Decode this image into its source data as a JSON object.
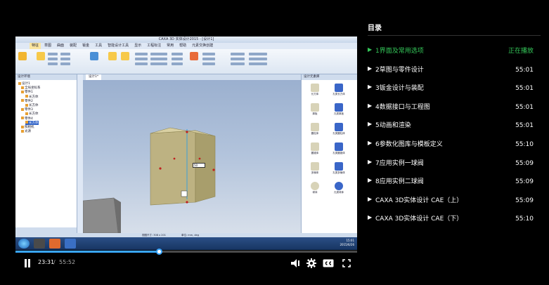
{
  "video": {
    "app_title": "CAXA 3D 实体设计2015 - [设计1]",
    "menu": [
      "特征",
      "草图",
      "曲面",
      "装配",
      "钣金",
      "工具",
      "智能设计工具",
      "显示",
      "工程标注",
      "常用",
      "帮助",
      "元素交换创建"
    ],
    "tree_header": "设计环境",
    "tree_items": [
      "设计1",
      "全局坐标系",
      "零件1",
      "长方体",
      "零件2",
      "长方体",
      "零件3",
      "长方体",
      "零件4",
      "长方体",
      "照相机",
      "光源"
    ],
    "tree_tabs": [
      "设置",
      "设计树",
      "属性"
    ],
    "viewport_tab": "设计1*",
    "dimension_value": "50",
    "right_panel_header": "设计元素库",
    "right_panel_items": [
      "长方体",
      "孔类长方体",
      "厚板",
      "孔类厚板",
      "圆柱体",
      "孔类圆柱体",
      "圆锥体",
      "孔类圆锥体",
      "多棱体",
      "孔类多棱体",
      "球体",
      "孔类球体"
    ],
    "status_text": "视图尺寸: 308 x 201",
    "status_unit": "单位: mm, deg",
    "taskbar_clock": "15:01",
    "taskbar_date": "2015/6/26",
    "taskbar_url": "http://www.caxa.cn"
  },
  "player": {
    "current_time": "23:31",
    "separator": "/",
    "total_time": "55:52",
    "progress": 0.421,
    "accent_color": "#3aa6ff"
  },
  "playlist": {
    "title": "目录",
    "items": [
      {
        "name": "1界面及常用选项",
        "duration": "正在播放",
        "active": true
      },
      {
        "name": "2草图与零件设计",
        "duration": "55:01",
        "active": false
      },
      {
        "name": "3钣金设计与装配",
        "duration": "55:01",
        "active": false
      },
      {
        "name": "4数据接口与工程图",
        "duration": "55:01",
        "active": false
      },
      {
        "name": "5动画和渲染",
        "duration": "55:01",
        "active": false
      },
      {
        "name": "6参数化图库与模板定义",
        "duration": "55:10",
        "active": false
      },
      {
        "name": "7应用实例一球阀",
        "duration": "55:09",
        "active": false
      },
      {
        "name": "8应用实例二球阀",
        "duration": "55:09",
        "active": false
      },
      {
        "name": "CAXA 3D实体设计 CAE（上）",
        "duration": "55:09",
        "active": false
      },
      {
        "name": "CAXA 3D实体设计 CAE（下）",
        "duration": "55:10",
        "active": false
      }
    ],
    "active_color": "#34c759"
  }
}
